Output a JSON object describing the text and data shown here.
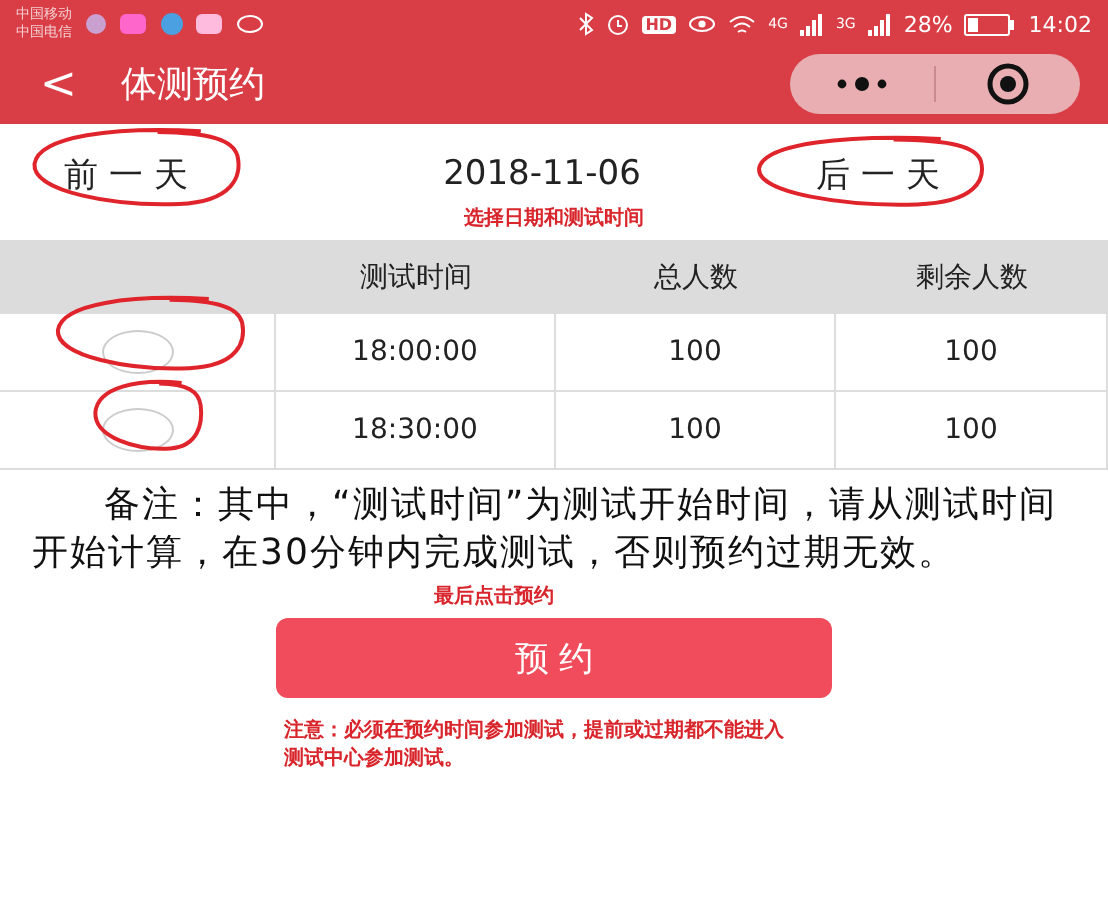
{
  "status_bar": {
    "carriers": [
      "中国移动",
      "中国电信"
    ],
    "hd": "HD",
    "network_1": "4G",
    "network_2": "3G",
    "battery_text": "28%",
    "time": "14:02"
  },
  "header": {
    "back": "<",
    "title": "体测预约"
  },
  "date_bar": {
    "prev": "前 一 天",
    "date": "2018-11-06",
    "next": "后 一 天",
    "hint": "选择日期和测试时间"
  },
  "table": {
    "columns": [
      "测试时间",
      "总人数",
      "剩余人数"
    ],
    "rows": [
      {
        "selected": false,
        "cells": [
          "18:00:00",
          "100",
          "100"
        ]
      },
      {
        "selected": false,
        "cells": [
          "18:30:00",
          "100",
          "100"
        ]
      }
    ]
  },
  "note": "备注：其中，“测试时间”为测试开始时间，请从测试时间开始计算，在30分钟内完成测试，否则预约过期无效。",
  "button_hint": "最后点击预约",
  "button": "预 约",
  "warning": "注意：必须在预约时间参加测试，提前或过期都不能进入测试中心参加测试。"
}
